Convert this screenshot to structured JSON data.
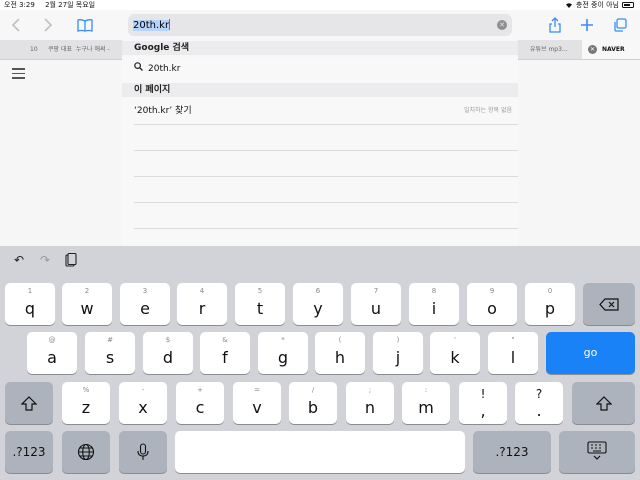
{
  "status": {
    "time": "오전 3:29",
    "date": "2월 27일 목요일",
    "right_text": "충전 중이 아님"
  },
  "toolbar": {
    "url_text": "20th.kr"
  },
  "tabs": [
    {
      "label": "10"
    },
    {
      "label": "쿠팡 대표"
    },
    {
      "label": "누구나 애써 -"
    },
    {
      "label": "유튜브 mp3..."
    },
    {
      "label": "NAVER"
    }
  ],
  "suggestions": {
    "section1_title": "Google 검색",
    "google_query": "20th.kr",
    "section2_title": "이 페이지",
    "find_label": "‘20th.kr’ 찾기",
    "find_note": "일치하는 항목 없음"
  },
  "keyboard": {
    "row1": [
      {
        "sub": "1",
        "main": "q"
      },
      {
        "sub": "2",
        "main": "w"
      },
      {
        "sub": "3",
        "main": "e"
      },
      {
        "sub": "4",
        "main": "r"
      },
      {
        "sub": "5",
        "main": "t"
      },
      {
        "sub": "6",
        "main": "y"
      },
      {
        "sub": "7",
        "main": "u"
      },
      {
        "sub": "8",
        "main": "i"
      },
      {
        "sub": "9",
        "main": "o"
      },
      {
        "sub": "0",
        "main": "p"
      }
    ],
    "row2": [
      {
        "sub": "@",
        "main": "a"
      },
      {
        "sub": "#",
        "main": "s"
      },
      {
        "sub": "$",
        "main": "d"
      },
      {
        "sub": "&",
        "main": "f"
      },
      {
        "sub": "*",
        "main": "g"
      },
      {
        "sub": "(",
        "main": "h"
      },
      {
        "sub": ")",
        "main": "j"
      },
      {
        "sub": "'",
        "main": "k"
      },
      {
        "sub": "\"",
        "main": "l"
      }
    ],
    "row3": [
      {
        "sub": "%",
        "main": "z"
      },
      {
        "sub": "-",
        "main": "x"
      },
      {
        "sub": "+",
        "main": "c"
      },
      {
        "sub": "=",
        "main": "v"
      },
      {
        "sub": "/",
        "main": "b"
      },
      {
        "sub": ";",
        "main": "n"
      },
      {
        "sub": ":",
        "main": "m"
      },
      {
        "sub": "!",
        "main": ","
      },
      {
        "sub": "?",
        "main": "."
      }
    ],
    "go_label": "go",
    "numbers_label": ".?123"
  }
}
